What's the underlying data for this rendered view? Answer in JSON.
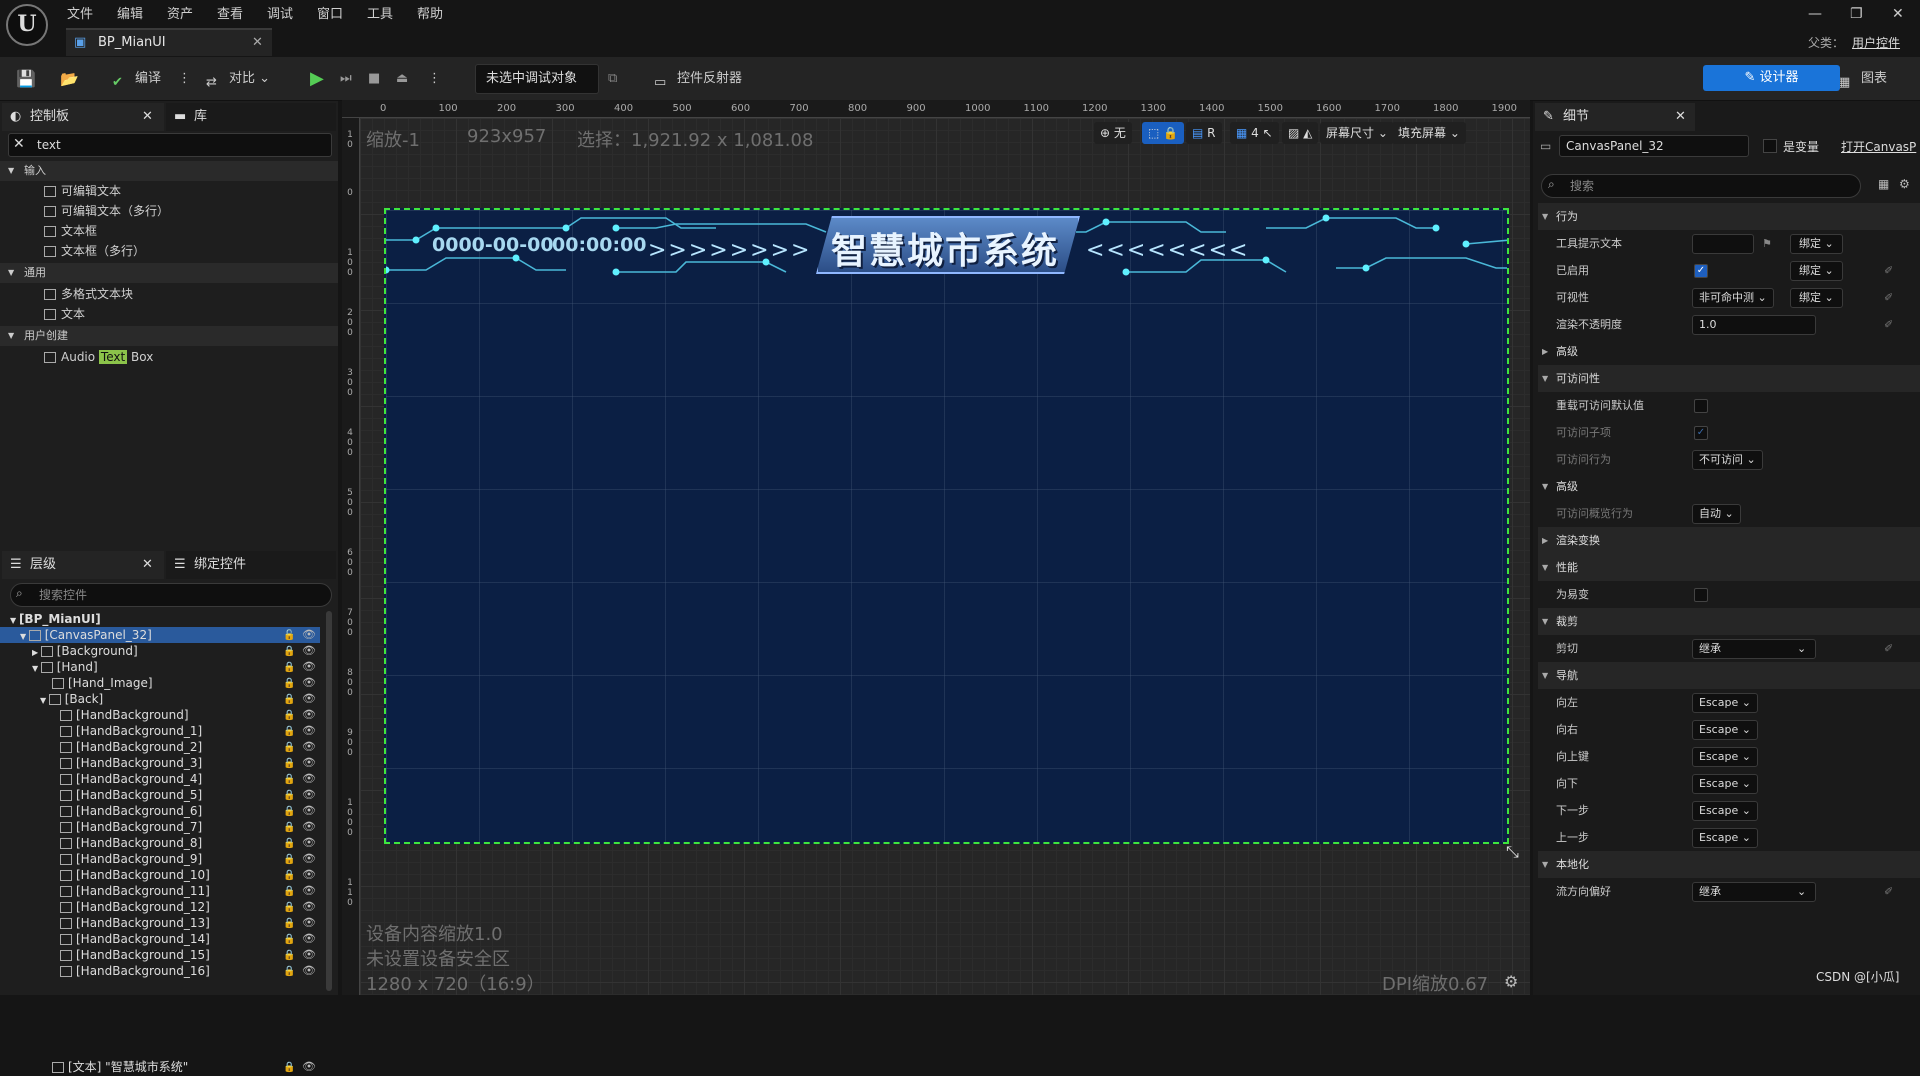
{
  "app": {
    "logo": "U",
    "doc_tab": "BP_MianUI",
    "parent_label": "父类：",
    "parent_value": "用户控件"
  },
  "menu": [
    "文件",
    "编辑",
    "资产",
    "查看",
    "调试",
    "窗口",
    "工具",
    "帮助"
  ],
  "toolbar": {
    "compile": "编译",
    "diff": "对比",
    "debug_target": "未选中调试对象",
    "reflector": "控件反射器",
    "designer": "设计器",
    "graph": "图表"
  },
  "palette": {
    "tab": "控制板",
    "tab2": "库",
    "search_value": "text",
    "categories": [
      {
        "name": "输入",
        "items": [
          "可编辑文本",
          "可编辑文本（多行）",
          "文本框",
          "文本框（多行）"
        ]
      },
      {
        "name": "通用",
        "items": [
          "多格式文本块",
          "文本"
        ]
      },
      {
        "name": "用户创建",
        "items": [
          "Audio ",
          "Text",
          " Box"
        ]
      }
    ]
  },
  "hierarchy": {
    "tab": "层级",
    "tab2": "绑定控件",
    "search_placeholder": "搜索控件",
    "root": "[BP_MianUI]",
    "rows": [
      "[CanvasPanel_32]",
      "[Background]",
      "[Hand]",
      "[Hand_Image]",
      "[Back]",
      "[HandBackground]",
      "[HandBackground_1]",
      "[HandBackground_2]",
      "[HandBackground_3]",
      "[HandBackground_4]",
      "[HandBackground_5]",
      "[HandBackground_6]",
      "[HandBackground_7]",
      "[HandBackground_8]",
      "[HandBackground_9]",
      "[HandBackground_10]",
      "[HandBackground_11]",
      "[HandBackground_12]",
      "[HandBackground_13]",
      "[HandBackground_14]",
      "[HandBackground_15]",
      "[HandBackground_16]",
      "[文本] \"智慧城市系统\""
    ]
  },
  "viewport": {
    "zoom": "缩放-1",
    "size": "923x957",
    "selection": "选择：1,921.92 x 1,081.08",
    "ruler": [
      "0",
      "100",
      "200",
      "300",
      "400",
      "500",
      "600",
      "700",
      "800",
      "900",
      "1000",
      "1100",
      "1200",
      "1300",
      "1400",
      "1500",
      "1600",
      "1700",
      "1800",
      "1900"
    ],
    "vtool": {
      "none": "无",
      "r": "R",
      "four": "4",
      "screen": "屏幕尺寸",
      "fill": "填充屏幕"
    },
    "bottom": [
      "设备内容缩放1.0",
      "未设置设备安全区",
      "1280 x 720（16:9）"
    ],
    "dpi": "DPI缩放0.67"
  },
  "canvas_content": {
    "date": "0000-00-00",
    "time": "00:00:00",
    "arrows_right": ">>>>>>>>",
    "arrows_left": "<<<<<<<<",
    "title": "智慧城市系统",
    "bg": "#0b1f44"
  },
  "details": {
    "tab": "细节",
    "name": "CanvasPanel_32",
    "is_var": "是变量",
    "open": "打开CanvasP",
    "search_placeholder": "搜索",
    "rows": {
      "s1": "行为",
      "tooltip": "工具提示文本",
      "bind": "绑定",
      "enabled": "已启用",
      "visibility": "可视性",
      "vis_value": "非可命中测",
      "opacity": "渲染不透明度",
      "opacity_value": "1.0",
      "adv": "高级",
      "s2": "可访问性",
      "override": "重载可访问默认值",
      "children": "可访问子项",
      "acc_beh": "可访问行为",
      "acc_value": "不可访问",
      "adv2": "高级",
      "summary": "可访问概览行为",
      "auto": "自动",
      "s3": "渲染变换",
      "s4": "性能",
      "volatile": "为易变",
      "s5": "裁剪",
      "clip": "剪切",
      "inherit": "继承",
      "s6": "导航",
      "left": "向左",
      "right": "向右",
      "up": "向上键",
      "down": "向下",
      "next": "下一步",
      "prev": "上一步",
      "escape": "Escape",
      "s7": "本地化",
      "flow": "流方向偏好"
    }
  },
  "watermark": "CSDN @[小瓜]"
}
